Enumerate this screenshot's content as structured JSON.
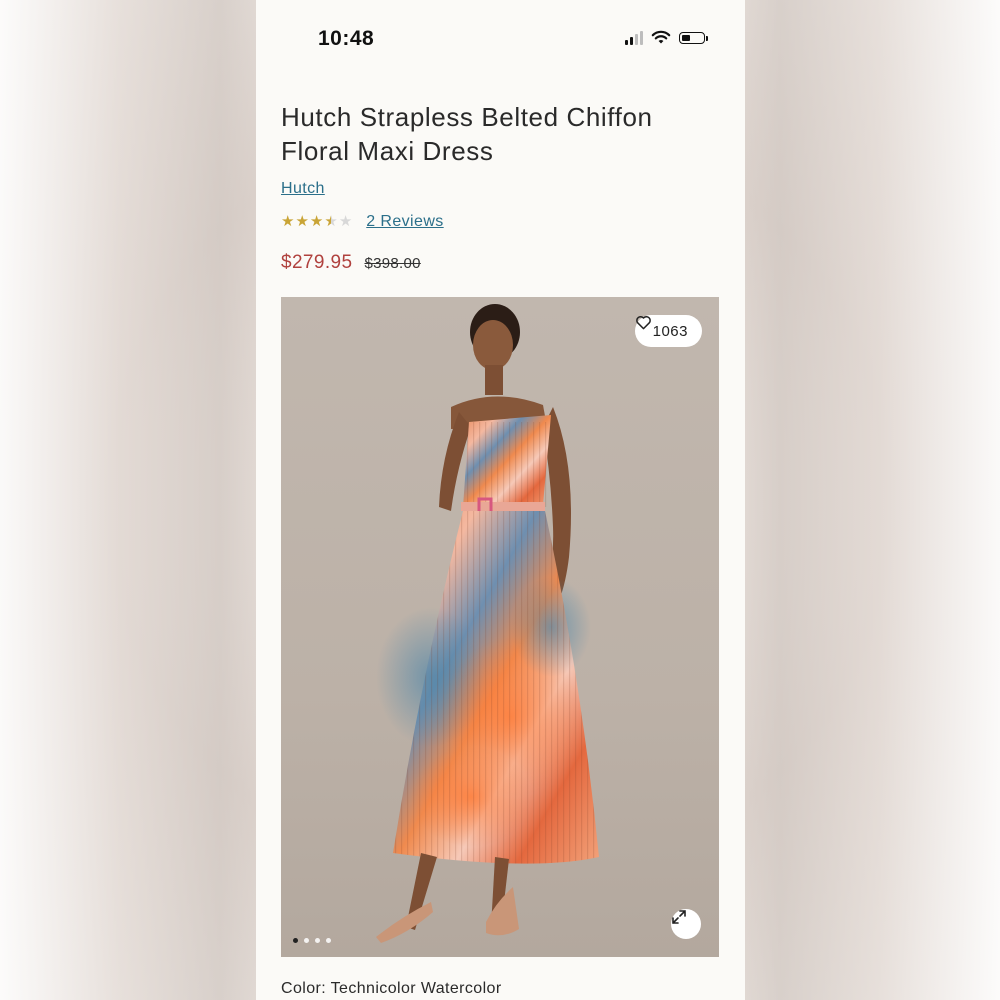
{
  "status_bar": {
    "time": "10:48"
  },
  "product": {
    "title": "Hutch Strapless Belted Chiffon Floral Maxi Dress",
    "brand": "Hutch",
    "rating": 3.5,
    "rating_max": 5,
    "reviews_label": "2 Reviews",
    "sale_price": "$279.95",
    "original_price": "$398.00"
  },
  "gallery": {
    "likes": "1063",
    "image_count": 4,
    "active_index": 0
  },
  "color": {
    "label": "Color:",
    "value": "Technicolor Watercolor"
  },
  "colors": {
    "link": "#2b6f8a",
    "sale": "#b0413e",
    "star": "#c9a436"
  }
}
